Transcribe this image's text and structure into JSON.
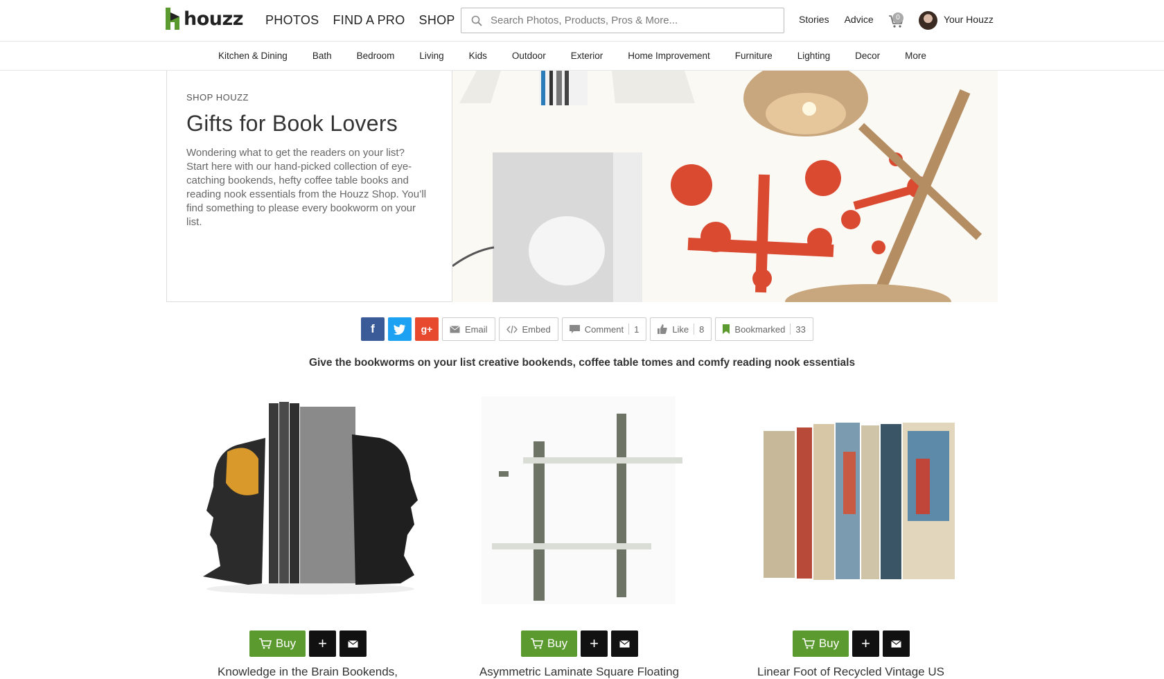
{
  "header": {
    "logo_text": "houzz",
    "nav": [
      "PHOTOS",
      "FIND A PRO",
      "SHOP"
    ],
    "search_placeholder": "Search Photos, Products, Pros & More...",
    "links": [
      "Stories",
      "Advice"
    ],
    "cart_count": "0",
    "account_label": "Your Houzz",
    "brand_color": "#5b9a2f"
  },
  "categories": [
    "Kitchen & Dining",
    "Bath",
    "Bedroom",
    "Living",
    "Kids",
    "Outdoor",
    "Exterior",
    "Home Improvement",
    "Furniture",
    "Lighting",
    "Decor",
    "More"
  ],
  "hero": {
    "kicker": "SHOP HOUZZ",
    "title": "Gifts for Book Lovers",
    "description": "Wondering what to get the readers on your list? Start here with our hand-picked collection of eye-catching bookends, hefty coffee table books and reading nook essentials from the Houzz Shop. You’ll find something to please every bookworm on your list."
  },
  "social": {
    "email": "Email",
    "embed": "Embed",
    "comment": "Comment",
    "comment_count": "1",
    "like": "Like",
    "like_count": "8",
    "bookmarked": "Bookmarked",
    "bookmarked_count": "33"
  },
  "subtitle": "Give the bookworms on your list creative bookends, coffee table tomes and comfy reading nook essentials",
  "products": [
    {
      "title": "Knowledge in the Brain Bookends,",
      "buy": "Buy"
    },
    {
      "title": "Asymmetric Laminate Square Floating",
      "buy": "Buy"
    },
    {
      "title": "Linear Foot of Recycled Vintage US",
      "buy": "Buy"
    }
  ]
}
